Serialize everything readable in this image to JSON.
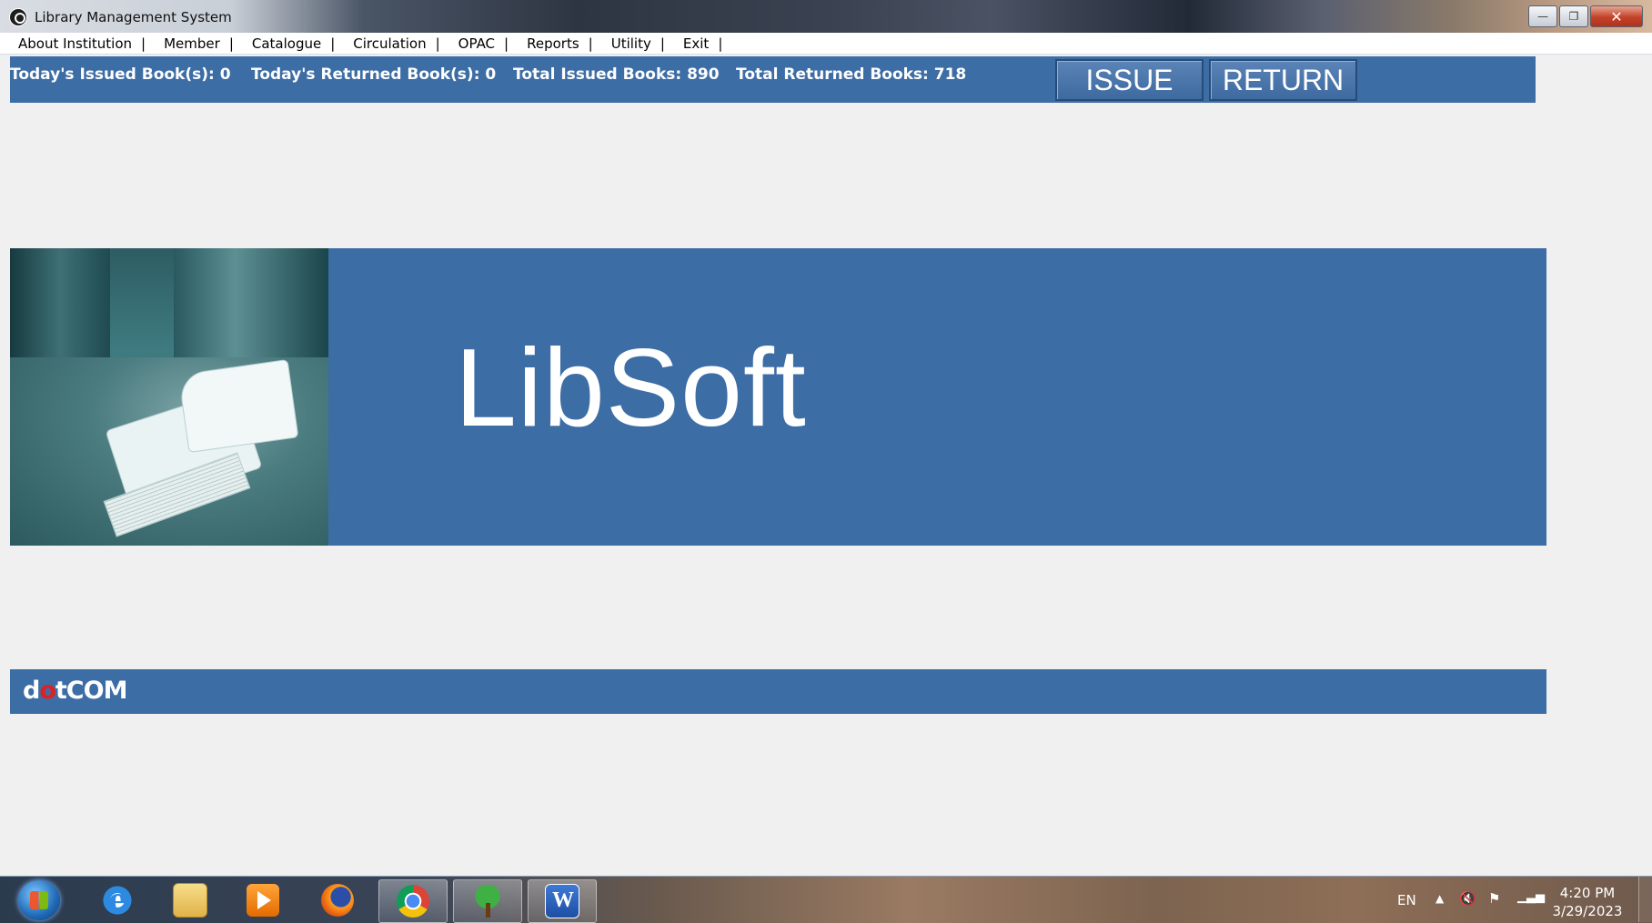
{
  "window": {
    "title": "Library Management System",
    "controls": {
      "minimize": "—",
      "restore": "❐",
      "close": "✕"
    }
  },
  "menu": {
    "items": [
      "About Institution",
      "Member",
      "Catalogue",
      "Circulation",
      "OPAC",
      "Reports",
      "Utility",
      "Exit"
    ],
    "separator": "|"
  },
  "stats": {
    "todays_issued": "Today's Issued Book(s): 0",
    "todays_returned": "Today's Returned Book(s): 0",
    "total_issued": "Total Issued Books: 890",
    "total_returned": "Total Returned Books: 718"
  },
  "actions": {
    "issue_label": "ISSUE",
    "return_label": "RETURN"
  },
  "banner": {
    "brand": "LibSoft",
    "photo": "library-aisle-open-book-image"
  },
  "footer": {
    "logo_parts": [
      "d",
      "o",
      "tCOM"
    ]
  },
  "taskbar": {
    "apps": [
      "start-button",
      "internet-explorer-icon",
      "file-explorer-icon",
      "media-player-icon",
      "firefox-icon",
      "chrome-icon",
      "libsoft-tree-icon",
      "word-icon"
    ],
    "language": "EN",
    "time": "4:20 PM",
    "date": "3/29/2023"
  },
  "colors": {
    "accent_blue": "#3d6da5",
    "background": "#f0f0f0",
    "logo_red": "#e02020"
  }
}
